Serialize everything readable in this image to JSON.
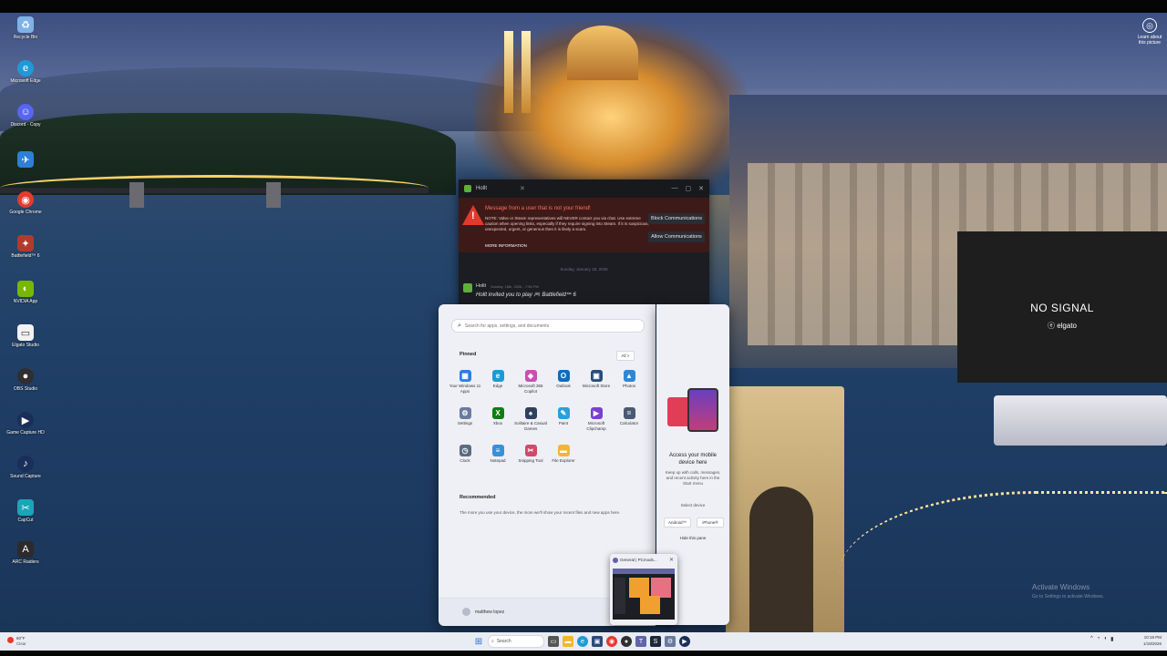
{
  "desktop_icons": [
    {
      "label": "Recycle Bin",
      "icon": "recycle-bin-icon",
      "color": "#7fb2e6"
    },
    {
      "label": "Microsoft Edge",
      "icon": "edge-icon",
      "color": "#1f9ad6"
    },
    {
      "label": "Discord - Copy",
      "icon": "discord-icon",
      "color": "#5865f2"
    },
    {
      "label": "",
      "icon": "network-icon",
      "color": "#2e7fd6"
    },
    {
      "label": "Google Chrome",
      "icon": "chrome-icon",
      "color": "#e23b2e"
    },
    {
      "label": "Battlefield™ 6",
      "icon": "battlefield-icon",
      "color": "#b33a2a"
    },
    {
      "label": "NVIDIA App",
      "icon": "nvidia-icon",
      "color": "#76b900"
    },
    {
      "label": "Elgato Studio",
      "icon": "file-icon",
      "color": "#f2f2f2"
    },
    {
      "label": "OBS Studio",
      "icon": "obs-icon",
      "color": "#302e31"
    },
    {
      "label": "Game Capture HD",
      "icon": "game-capture-icon",
      "color": "#1a2e5a"
    },
    {
      "label": "Sound Capture",
      "icon": "sound-capture-icon",
      "color": "#1a2e5a"
    },
    {
      "label": "CapCut",
      "icon": "capcut-icon",
      "color": "#1aa6b7"
    },
    {
      "label": "ARC Raiders",
      "icon": "arc-raiders-icon",
      "color": "#2b2b2b"
    }
  ],
  "learn_picture": {
    "label": "Learn about this picture",
    "icon": "camera-icon"
  },
  "steam": {
    "title": "Hollt",
    "warning_title": "Message from a user that is not your friend!",
    "warning_body": "NOTE: Valve or Steam representatives will NEVER contact you via chat. Use extreme caution when opening links, especially if they require signing into Steam. If it is suspicious, unexpected, urgent, or generous then it is likely a scam.",
    "more_info": "MORE INFORMATION",
    "block_label": "Block Communications",
    "allow_label": "Allow Communications",
    "date_divider": "Sunday, January 18, 2026",
    "msg_sender": "Hollt",
    "msg_meta": "Sunday, 18th, 2026 - 7:56 PM",
    "msg_text": "Hollt invited you to play 🎮 Battlefield™ 6"
  },
  "start_menu": {
    "search_placeholder": "Search for apps, settings, and documents",
    "pinned_label": "Pinned",
    "all_label": "All  >",
    "apps": [
      {
        "label": "Your Windows 11 Apps",
        "icon": "windows-apps-icon",
        "color": "#2b7de9",
        "glyph": "▦"
      },
      {
        "label": "Edge",
        "icon": "edge-icon",
        "color": "#1f9ad6",
        "glyph": "e"
      },
      {
        "label": "Microsoft 365 Copilot",
        "icon": "copilot-icon",
        "color": "#c94fb3",
        "glyph": "◆"
      },
      {
        "label": "Outlook",
        "icon": "outlook-icon",
        "color": "#0f6cbd",
        "glyph": "O"
      },
      {
        "label": "Microsoft Store",
        "icon": "store-icon",
        "color": "#2a4a7a",
        "glyph": "▣"
      },
      {
        "label": "Photos",
        "icon": "photos-icon",
        "color": "#2d87d8",
        "glyph": "▲"
      },
      {
        "label": "Settings",
        "icon": "gear-icon",
        "color": "#6b7aa0",
        "glyph": "⚙"
      },
      {
        "label": "Xbox",
        "icon": "xbox-icon",
        "color": "#107c10",
        "glyph": "X"
      },
      {
        "label": "Solitaire & Casual Games",
        "icon": "solitaire-icon",
        "color": "#2f3f5f",
        "glyph": "♠"
      },
      {
        "label": "Paint",
        "icon": "paint-icon",
        "color": "#2aa0d8",
        "glyph": "✎"
      },
      {
        "label": "Microsoft Clipchamp",
        "icon": "clipchamp-icon",
        "color": "#7a3fd0",
        "glyph": "▶"
      },
      {
        "label": "Calculator",
        "icon": "calculator-icon",
        "color": "#4a5a72",
        "glyph": "="
      },
      {
        "label": "Clock",
        "icon": "clock-icon",
        "color": "#5a6a82",
        "glyph": "◷"
      },
      {
        "label": "Notepad",
        "icon": "notepad-icon",
        "color": "#3a8fd8",
        "glyph": "≡"
      },
      {
        "label": "Snipping Tool",
        "icon": "snipping-tool-icon",
        "color": "#d04a6a",
        "glyph": "✂"
      },
      {
        "label": "File Explorer",
        "icon": "folder-icon",
        "color": "#f2b632",
        "glyph": "▬"
      }
    ],
    "recommended_label": "Recommended",
    "recommended_text": "The more you use your device, the more we'll show your recent files and new apps here.",
    "user_name": "matthew lopez"
  },
  "phone_link": {
    "title": "Access your mobile device here",
    "subtitle": "Keep up with calls, messages, and recent activity here in the Start menu",
    "select_label": "Select device",
    "android_label": "Android™",
    "iphone_label": "iPhone®",
    "hide_label": "Hide this pane"
  },
  "thumbnail": {
    "title": "General | PCmods..."
  },
  "elgato": {
    "no_signal": "NO SIGNAL",
    "brand": "ⓔ elgato"
  },
  "activate": {
    "title": "Activate Windows",
    "subtitle": "Go to Settings to activate Windows."
  },
  "taskbar": {
    "weather_temp": "60°F",
    "weather_cond": "Clear",
    "search_label": "Search",
    "time": "10:19 PM",
    "date": "1/18/2026"
  },
  "colors": {
    "warning_red": "#e03a2f",
    "steam_green": "#5fb03a"
  }
}
